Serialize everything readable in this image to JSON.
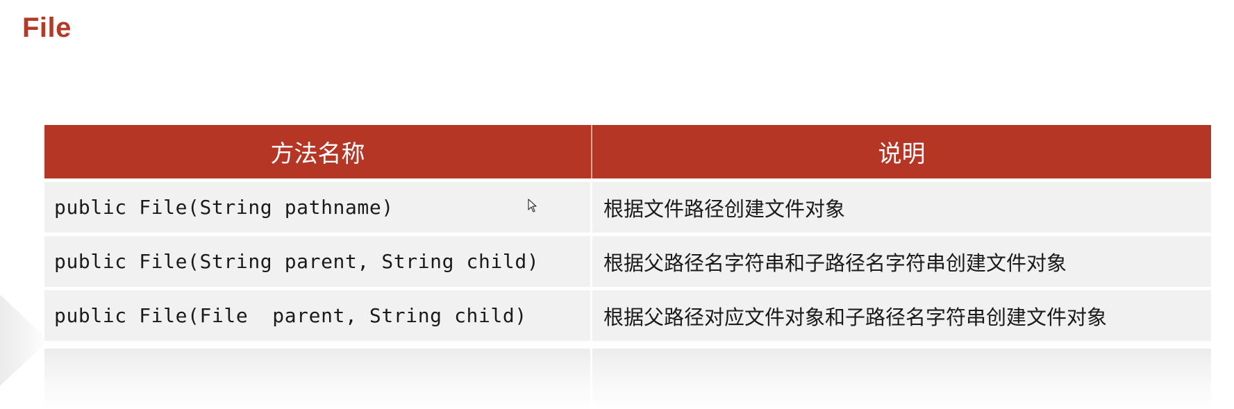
{
  "title": "File",
  "table": {
    "headers": [
      "方法名称",
      "说明"
    ],
    "rows": [
      {
        "method": "public File(String pathname)",
        "description": "根据文件路径创建文件对象"
      },
      {
        "method": "public File(String parent, String child)",
        "description": "根据父路径名字符串和子路径名字符串创建文件对象"
      },
      {
        "method": "public File(File  parent, String child)",
        "description": "根据父路径对应文件对象和子路径名字符串创建文件对象"
      }
    ]
  },
  "colors": {
    "accent": "#b53625",
    "title": "#b53a25",
    "row_bg": "#f1f1f1"
  },
  "icons": {
    "cursor": "mouse-pointer-icon"
  }
}
